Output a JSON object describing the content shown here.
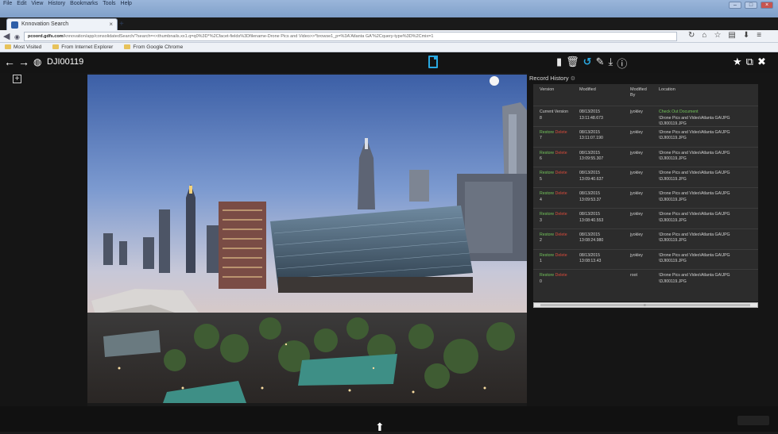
{
  "browser": {
    "menu": [
      "File",
      "Edit",
      "View",
      "History",
      "Bookmarks",
      "Tools",
      "Help"
    ],
    "tab_title": "Knnovation Search",
    "url_prefix": "pcoord.gdfs.com",
    "url_rest": "/knnovation/app/consolidatedSearch/?search=<<thumbnails.xx1.q=q0%3D*%2Cfacet-fields%3Dfilename-Drone Pics and Video>>*browse1_p=%3A'Atlanta GA'%2Cquery-type%3D%2Cmix=1",
    "bookmarks": [
      "Most Visited",
      "From Internet Explorer",
      "From Google Chrome"
    ]
  },
  "app": {
    "doc_title": "DJI00119"
  },
  "record_history": {
    "title": "Record History",
    "headers": {
      "version": "Version",
      "modified": "Modified",
      "modified_by": [
        "Modified",
        "By"
      ],
      "location": "Location"
    },
    "rows": [
      {
        "v1": "Current Version",
        "v2": "8",
        "d1": "08/13/2015",
        "d2": "13:11:48.673",
        "by": "jyokley",
        "l1": "Check Out Document",
        "l2": "\\Drone Pics and Video\\Atlanta GA\\JPG",
        "l3": "\\DJI00119.JPG"
      },
      {
        "v1": "Restore",
        "v1b": "Delete",
        "v2": "7",
        "d1": "08/13/2015",
        "d2": "13:11:07.190",
        "by": "jyokley",
        "l1": "",
        "l2": "\\Drone Pics and Video\\Atlanta GA\\JPG",
        "l3": "\\DJI00119.JPG"
      },
      {
        "v1": "Restore",
        "v1b": "Delete",
        "v2": "6",
        "d1": "08/13/2015",
        "d2": "13:09:55.307",
        "by": "jyokley",
        "l1": "",
        "l2": "\\Drone Pics and Video\\Atlanta GA\\JPG",
        "l3": "\\DJI00119.JPG"
      },
      {
        "v1": "Restore",
        "v1b": "Delete",
        "v2": "5",
        "d1": "08/13/2015",
        "d2": "13:09:40.637",
        "by": "jyokley",
        "l1": "",
        "l2": "\\Drone Pics and Video\\Atlanta GA\\JPG",
        "l3": "\\DJI00119.JPG"
      },
      {
        "v1": "Restore",
        "v1b": "Delete",
        "v2": "4",
        "d1": "08/13/2015",
        "d2": "13:09:53.37",
        "by": "jyokley",
        "l1": "",
        "l2": "\\Drone Pics and Video\\Atlanta GA\\JPG",
        "l3": "\\DJI00119.JPG"
      },
      {
        "v1": "Restore",
        "v1b": "Delete",
        "v2": "3",
        "d1": "08/13/2015",
        "d2": "13:08:40.553",
        "by": "jyokley",
        "l1": "",
        "l2": "\\Drone Pics and Video\\Atlanta GA\\JPG",
        "l3": "\\DJI00119.JPG"
      },
      {
        "v1": "Restore",
        "v1b": "Delete",
        "v2": "2",
        "d1": "08/13/2015",
        "d2": "13:08:24.980",
        "by": "jyokley",
        "l1": "",
        "l2": "\\Drone Pics and Video\\Atlanta GA\\JPG",
        "l3": "\\DJI00119.JPG"
      },
      {
        "v1": "Restore",
        "v1b": "Delete",
        "v2": "1",
        "d1": "08/13/2015",
        "d2": "13:08:13.43",
        "by": "jyokley",
        "l1": "",
        "l2": "\\Drone Pics and Video\\Atlanta GA\\JPG",
        "l3": "\\DJI00119.JPG"
      },
      {
        "v1": "Restore",
        "v1b": "Delete",
        "v2": "0",
        "d1": "",
        "d2": "",
        "by": "root",
        "l1": "",
        "l2": "\\Drone Pics and Video\\Atlanta GA\\JPG",
        "l3": "\\DJI00119.JPG"
      }
    ]
  },
  "colors": {
    "accent": "#2aa9e2",
    "restore": "#72c45a",
    "delete": "#d94b3b",
    "toolbar_bg": "#141414"
  },
  "icons": {
    "toolbar_left": [
      "back-arrow-icon",
      "forward-arrow-icon",
      "globe-icon"
    ],
    "toolbar_mid": [
      "document-icon"
    ],
    "toolbar_actions": [
      "file-info-icon",
      "trash-icon",
      "history-icon",
      "edit-icon",
      "download-icon",
      "info-icon"
    ],
    "toolbar_right": [
      "star-icon",
      "external-link-icon",
      "close-icon"
    ]
  }
}
